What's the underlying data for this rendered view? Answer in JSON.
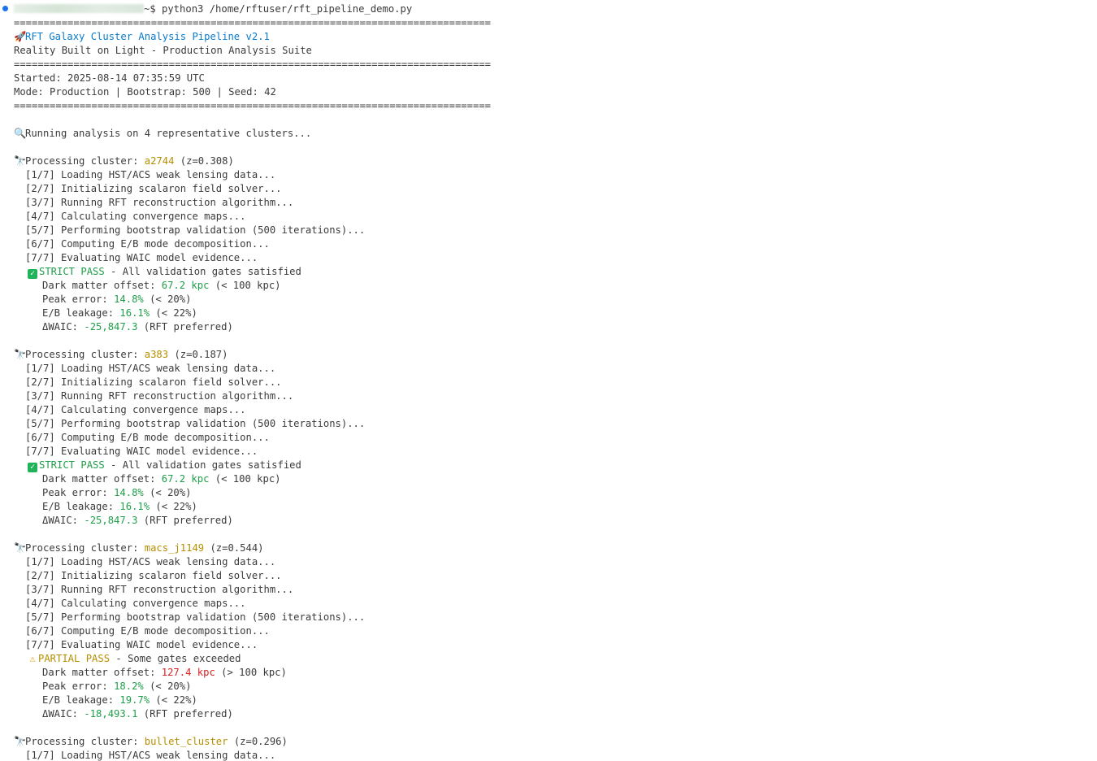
{
  "prompt": {
    "suffix": "~$ python3 /home/rftuser/rft_pipeline_demo.py"
  },
  "header": {
    "rule": "================================================================================",
    "title": "RFT Galaxy Cluster Analysis Pipeline v2.1",
    "subtitle": "Reality Built on Light - Production Analysis Suite",
    "started": "Started: 2025-08-14 07:35:59 UTC",
    "mode": "Mode: Production | Bootstrap: 500 | Seed: 42"
  },
  "running": "Running analysis on 4 representative clusters...",
  "steps": [
    "[1/7] Loading HST/ACS weak lensing data...",
    "[2/7] Initializing scalaron field solver...",
    "[3/7] Running RFT reconstruction algorithm...",
    "[4/7] Calculating convergence maps...",
    "[5/7] Performing bootstrap validation (500 iterations)...",
    "[6/7] Computing E/B mode decomposition...",
    "[7/7] Evaluating WAIC model evidence..."
  ],
  "labels": {
    "processing": "Processing cluster: ",
    "dm_offset": "Dark matter offset: ",
    "peak_error": "Peak error: ",
    "eb_leakage": "E/B leakage: ",
    "dwaic": "ΔWAIC: ",
    "rft_pref": " (RFT preferred)"
  },
  "clusters": [
    {
      "name": "a2744",
      "z": " (z=0.308)",
      "status": "STRICT PASS",
      "status_msg": " - All validation gates satisfied",
      "dm_value": "67.2 kpc",
      "dm_gate": " (< 100 kpc)",
      "peak_value": "14.8%",
      "peak_gate": " (< 20%)",
      "eb_value": "16.1%",
      "eb_gate": " (< 22%)",
      "waic_value": "-25,847.3"
    },
    {
      "name": "a383",
      "z": " (z=0.187)",
      "status": "STRICT PASS",
      "status_msg": " - All validation gates satisfied",
      "dm_value": "67.2 kpc",
      "dm_gate": " (< 100 kpc)",
      "peak_value": "14.8%",
      "peak_gate": " (< 20%)",
      "eb_value": "16.1%",
      "eb_gate": " (< 22%)",
      "waic_value": "-25,847.3"
    },
    {
      "name": "macs_j1149",
      "z": " (z=0.544)",
      "status": "PARTIAL PASS",
      "status_msg": " - Some gates exceeded",
      "dm_value": "127.4 kpc",
      "dm_gate": " (> 100 kpc)",
      "peak_value": "18.2%",
      "peak_gate": " (< 20%)",
      "eb_value": "19.7%",
      "eb_gate": " (< 22%)",
      "waic_value": "-18,493.1"
    },
    {
      "name": "bullet_cluster",
      "z": " (z=0.296)"
    }
  ],
  "colors": {
    "title": "#0a7acc",
    "cluster_name": "#b58f00",
    "good_value": "#1f9f4a",
    "bad_value": "#d92020",
    "warning": "#b58f00"
  }
}
